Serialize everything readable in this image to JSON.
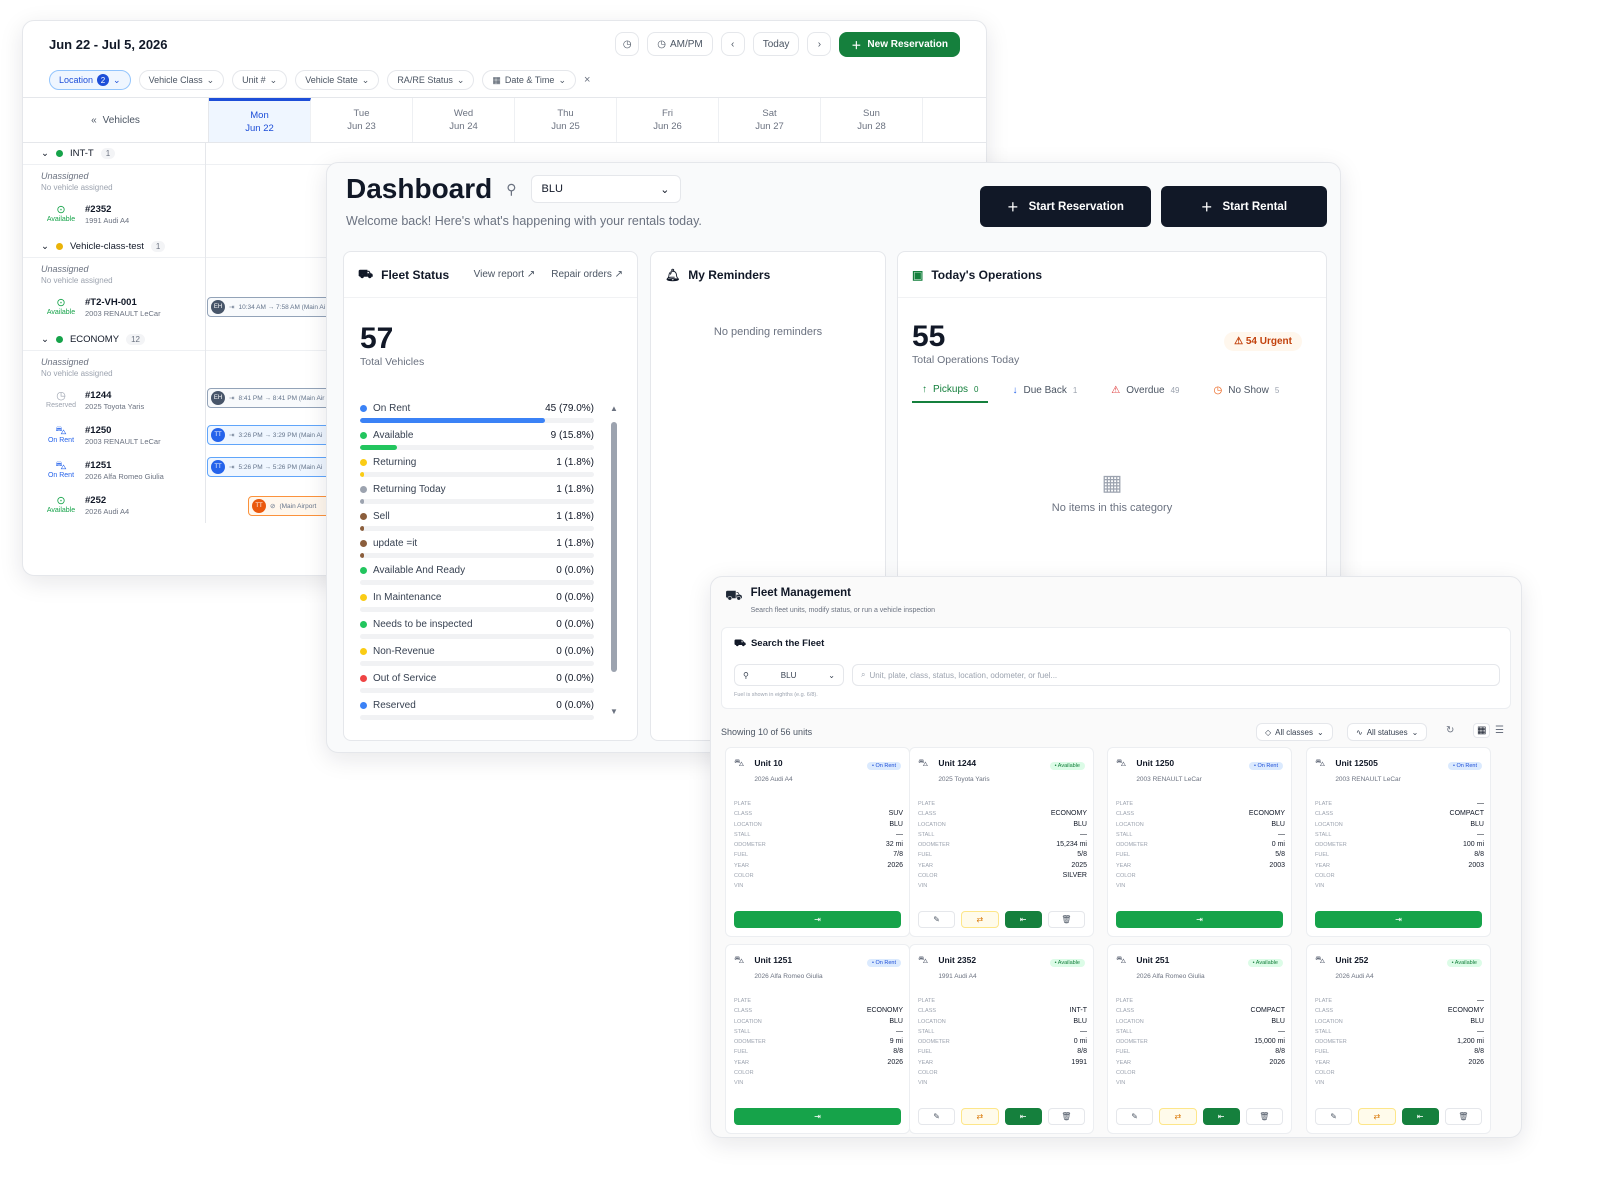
{
  "calendar": {
    "range": "Jun 22 - Jul 5, 2026",
    "ampm": "AM/PM",
    "today": "Today",
    "new_reservation": "New Reservation",
    "filters": [
      "Location",
      "Vehicle Class",
      "Unit #",
      "Vehicle State",
      "RA/RE Status",
      "Date & Time"
    ],
    "location_count": "2",
    "vehicles_label": "Vehicles",
    "days": [
      {
        "dow": "Mon",
        "date": "Jun 22"
      },
      {
        "dow": "Tue",
        "date": "Jun 23"
      },
      {
        "dow": "Wed",
        "date": "Jun 24"
      },
      {
        "dow": "Thu",
        "date": "Jun 25"
      },
      {
        "dow": "Fri",
        "date": "Jun 26"
      },
      {
        "dow": "Sat",
        "date": "Jun 27"
      },
      {
        "dow": "Sun",
        "date": "Jun 28"
      }
    ],
    "unassigned": "Unassigned",
    "no_vehicle": "No vehicle assigned",
    "groups": [
      {
        "name": "INT-T",
        "count": "1",
        "color": "#16a34a"
      },
      {
        "name": "Vehicle-class-test",
        "count": "1",
        "color": "#eab308"
      },
      {
        "name": "ECONOMY",
        "count": "12",
        "color": "#16a34a"
      }
    ],
    "vehicles": [
      {
        "unit": "#2352",
        "desc": "1991 Audi A4",
        "status": "Available"
      },
      {
        "unit": "#T2-VH-001",
        "desc": "2003 RENAULT LeCar",
        "status": "Available"
      },
      {
        "unit": "#1244",
        "desc": "2025 Toyota Yaris",
        "status": "Reserved"
      },
      {
        "unit": "#1250",
        "desc": "2003 RENAULT LeCar",
        "status": "On Rent"
      },
      {
        "unit": "#1251",
        "desc": "2026 Alfa Romeo Giulia",
        "status": "On Rent"
      },
      {
        "unit": "#252",
        "desc": "2026 Audi A4",
        "status": "Available"
      }
    ],
    "bookings": [
      {
        "initials": "EH",
        "text": "10:34 AM → 7:58 AM (Main Ai"
      },
      {
        "initials": "EH",
        "text": "8:41 PM → 8:41 PM (Main Air"
      },
      {
        "initials": "TT",
        "text": "3:26 PM → 3:29 PM (Main Ai"
      },
      {
        "initials": "TT",
        "text": "5:26 PM → 5:26 PM (Main Ai"
      },
      {
        "initials": "TT",
        "text": "(Main Airport"
      }
    ]
  },
  "dashboard": {
    "title": "Dashboard",
    "location": "BLU",
    "welcome": "Welcome back! Here's what's happening with your rentals today.",
    "start_reservation": "Start Reservation",
    "start_rental": "Start Rental",
    "fleet_status": {
      "title": "Fleet Status",
      "view_report": "View report",
      "repair_orders": "Repair orders",
      "total": "57",
      "total_label": "Total Vehicles",
      "rows": [
        {
          "label": "On Rent",
          "value": "45 (79.0%)",
          "pct": 79.0,
          "color": "#3b82f6"
        },
        {
          "label": "Available",
          "value": "9 (15.8%)",
          "pct": 15.8,
          "color": "#22c55e"
        },
        {
          "label": "Returning",
          "value": "1 (1.8%)",
          "pct": 1.8,
          "color": "#facc15"
        },
        {
          "label": "Returning Today",
          "value": "1 (1.8%)",
          "pct": 1.8,
          "color": "#9ca3af"
        },
        {
          "label": "Sell",
          "value": "1 (1.8%)",
          "pct": 1.8,
          "color": "#8b5e3c"
        },
        {
          "label": "update =it",
          "value": "1 (1.8%)",
          "pct": 1.8,
          "color": "#8b5e3c"
        },
        {
          "label": "Available And Ready",
          "value": "0 (0.0%)",
          "pct": 0,
          "color": "#22c55e"
        },
        {
          "label": "In Maintenance",
          "value": "0 (0.0%)",
          "pct": 0,
          "color": "#facc15"
        },
        {
          "label": "Needs to be inspected",
          "value": "0 (0.0%)",
          "pct": 0,
          "color": "#22c55e"
        },
        {
          "label": "Non-Revenue",
          "value": "0 (0.0%)",
          "pct": 0,
          "color": "#facc15"
        },
        {
          "label": "Out of Service",
          "value": "0 (0.0%)",
          "pct": 0,
          "color": "#ef4444"
        },
        {
          "label": "Reserved",
          "value": "0 (0.0%)",
          "pct": 0,
          "color": "#3b82f6"
        }
      ]
    },
    "reminders": {
      "title": "My Reminders",
      "empty": "No pending reminders"
    },
    "operations": {
      "title": "Today's Operations",
      "total": "55",
      "total_label": "Total Operations Today",
      "urgent": "54 Urgent",
      "tabs": [
        {
          "label": "Pickups",
          "count": "0"
        },
        {
          "label": "Due Back",
          "count": "1"
        },
        {
          "label": "Overdue",
          "count": "49"
        },
        {
          "label": "No Show",
          "count": "5"
        }
      ],
      "empty": "No items in this category"
    }
  },
  "fleet": {
    "title": "Fleet Management",
    "subtitle": "Search fleet units, modify status, or run a vehicle inspection",
    "search_title": "Search the Fleet",
    "location": "BLU",
    "search_placeholder": "Unit, plate, class, status, location, odometer, or fuel...",
    "fuel_note": "Fuel is shown in eighths (e.g. 6/8).",
    "showing": "Showing 10 of 56 units",
    "all_classes": "All classes",
    "all_statuses": "All statuses",
    "field_labels": [
      "PLATE",
      "CLASS",
      "LOCATION",
      "STALL",
      "ODOMETER",
      "FUEL",
      "YEAR",
      "COLOR",
      "VIN"
    ],
    "units": [
      {
        "name": "Unit 10",
        "desc": "2026 Audi A4",
        "status": "On Rent",
        "vals": [
          "",
          "SUV",
          "BLU",
          "—",
          "32 mi",
          "7/8",
          "2026",
          "",
          ""
        ]
      },
      {
        "name": "Unit 1244",
        "desc": "2025 Toyota Yaris",
        "status": "Available",
        "vals": [
          "",
          "ECONOMY",
          "BLU",
          "—",
          "15,234 mi",
          "5/8",
          "2025",
          "SILVER",
          ""
        ]
      },
      {
        "name": "Unit 1250",
        "desc": "2003 RENAULT LeCar",
        "status": "On Rent",
        "vals": [
          "",
          "ECONOMY",
          "BLU",
          "—",
          "0 mi",
          "5/8",
          "2003",
          "",
          ""
        ]
      },
      {
        "name": "Unit 12505",
        "desc": "2003 RENAULT LeCar",
        "status": "On Rent",
        "vals": [
          "—",
          "COMPACT",
          "BLU",
          "—",
          "100 mi",
          "8/8",
          "2003",
          "",
          ""
        ]
      },
      {
        "name": "Unit 1251",
        "desc": "2026 Alfa Romeo Giulia",
        "status": "On Rent",
        "vals": [
          "",
          "ECONOMY",
          "BLU",
          "—",
          "9 mi",
          "8/8",
          "2026",
          "",
          ""
        ]
      },
      {
        "name": "Unit 2352",
        "desc": "1991 Audi A4",
        "status": "Available",
        "vals": [
          "",
          "INT-T",
          "BLU",
          "—",
          "0 mi",
          "8/8",
          "1991",
          "",
          ""
        ]
      },
      {
        "name": "Unit 251",
        "desc": "2026 Alfa Romeo Giulia",
        "status": "Available",
        "vals": [
          "",
          "COMPACT",
          "BLU",
          "—",
          "15,000 mi",
          "8/8",
          "2026",
          "",
          ""
        ]
      },
      {
        "name": "Unit 252",
        "desc": "2026 Audi A4",
        "status": "Available",
        "vals": [
          "—",
          "ECONOMY",
          "BLU",
          "—",
          "1,200 mi",
          "8/8",
          "2026",
          "",
          ""
        ]
      }
    ]
  }
}
